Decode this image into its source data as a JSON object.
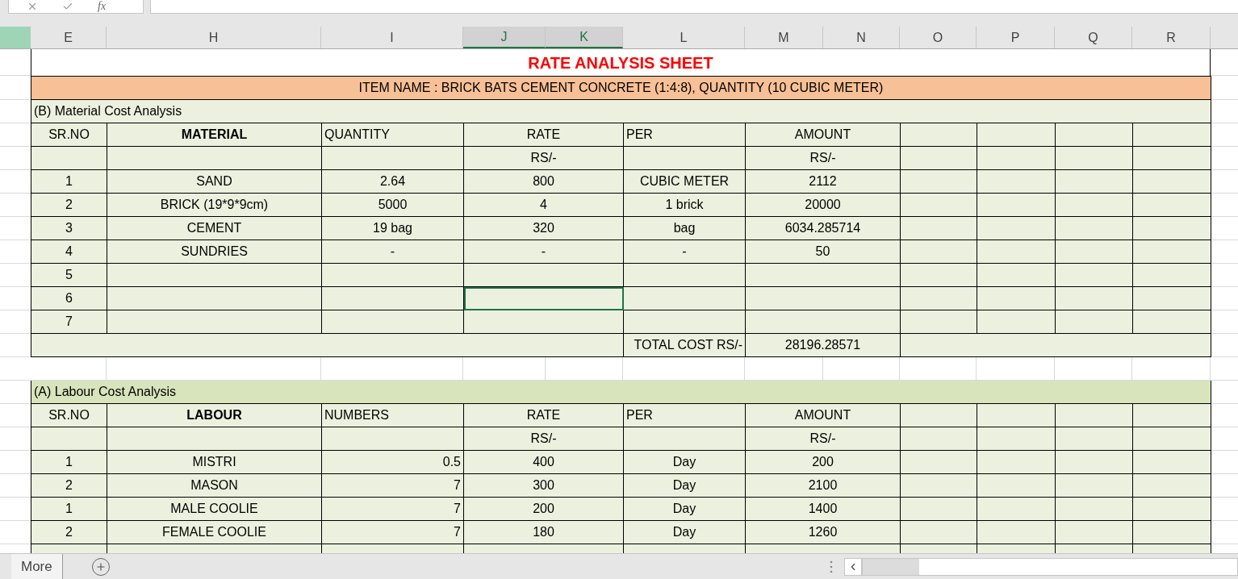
{
  "formula_bar": {
    "function_label": "fx"
  },
  "column_headers": [
    {
      "label": "E",
      "selected": false
    },
    {
      "label": "H",
      "selected": false
    },
    {
      "label": "I",
      "selected": false
    },
    {
      "label": "J",
      "selected": true
    },
    {
      "label": "K",
      "selected": true
    },
    {
      "label": "L",
      "selected": false
    },
    {
      "label": "M",
      "selected": false
    },
    {
      "label": "N",
      "selected": false
    },
    {
      "label": "O",
      "selected": false
    },
    {
      "label": "P",
      "selected": false
    },
    {
      "label": "Q",
      "selected": false
    },
    {
      "label": "R",
      "selected": false
    }
  ],
  "title": "RATE ANALYSIS SHEET",
  "item_name": "ITEM NAME : BRICK BATS CEMENT CONCRETE (1:4:8), QUANTITY (10 CUBIC METER)",
  "material": {
    "heading": "(B) Material Cost Analysis",
    "columns": [
      "SR.NO",
      "MATERIAL",
      "QUANTITY",
      "RATE",
      "PER",
      "AMOUNT"
    ],
    "rate_unit": "RS/-",
    "amount_unit": "RS/-",
    "rows": [
      {
        "sr": "1",
        "name": "SAND",
        "qty": "2.64",
        "rate": "800",
        "per": "CUBIC METER",
        "amount": "2112",
        "selected": false
      },
      {
        "sr": "2",
        "name": "BRICK (19*9*9cm)",
        "qty": "5000",
        "rate": "4",
        "per": "1 brick",
        "amount": "20000",
        "selected": false
      },
      {
        "sr": "3",
        "name": "CEMENT",
        "qty": "19 bag",
        "rate": "320",
        "per": "bag",
        "amount": "6034.285714",
        "selected": false
      },
      {
        "sr": "4",
        "name": "SUNDRIES",
        "qty": "-",
        "rate": "-",
        "per": "-",
        "amount": "50",
        "selected": false
      },
      {
        "sr": "5",
        "selected": false
      },
      {
        "sr": "6",
        "selected": true
      },
      {
        "sr": "7",
        "selected": false
      }
    ],
    "total_label": "TOTAL COST RS/-",
    "total": "28196.28571"
  },
  "labour": {
    "heading": "(A) Labour Cost Analysis",
    "columns": [
      "SR.NO",
      "LABOUR",
      "NUMBERS",
      "RATE",
      "PER",
      "AMOUNT"
    ],
    "rate_unit": "RS/-",
    "amount_unit": "RS/-",
    "rows": [
      {
        "sr": "1",
        "name": "MISTRI",
        "qty": "0.5",
        "rate": "400",
        "per": "Day",
        "amount": "200",
        "selected": false
      },
      {
        "sr": "2",
        "name": "MASON",
        "qty": "7",
        "rate": "300",
        "per": "Day",
        "amount": "2100",
        "selected": false
      },
      {
        "sr": "1",
        "name": "MALE COOLIE",
        "qty": "7",
        "rate": "200",
        "per": "Day",
        "amount": "1400",
        "selected": false
      },
      {
        "sr": "2",
        "name": "FEMALE COOLIE",
        "qty": "7",
        "rate": "180",
        "per": "Day",
        "amount": "1260",
        "selected": false
      }
    ]
  },
  "sheet_bar": {
    "more_tab": "More"
  }
}
